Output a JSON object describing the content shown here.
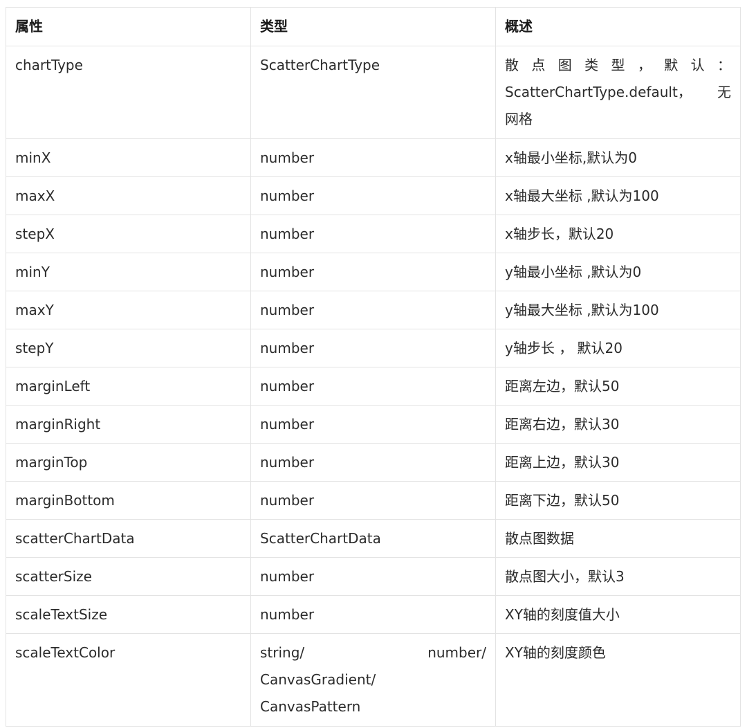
{
  "headers": {
    "property": "属性",
    "type": "类型",
    "description": "概述"
  },
  "rows": [
    {
      "property": "chartType",
      "type": "ScatterChartType",
      "description_line1": [
        "散",
        "点",
        "图",
        "类",
        "型",
        "，",
        "默",
        "认",
        "："
      ],
      "description_line2a": "ScatterChartType.default，",
      "description_line2b": "无",
      "description_line3": "网格"
    },
    {
      "property": "minX",
      "type": "number",
      "description": "x轴最小坐标,默认为0"
    },
    {
      "property": "maxX",
      "type": "number",
      "description": "x轴最大坐标 ,默认为100"
    },
    {
      "property": "stepX",
      "type": "number",
      "description": "x轴步长，默认20"
    },
    {
      "property": "minY",
      "type": "number",
      "description": "y轴最小坐标 ,默认为0"
    },
    {
      "property": "maxY",
      "type": "number",
      "description": "y轴最大坐标 ,默认为100"
    },
    {
      "property": "stepY",
      "type": "number",
      "description": "y轴步长 ， 默认20"
    },
    {
      "property": "marginLeft",
      "type": "number",
      "description": "距离左边，默认50"
    },
    {
      "property": "marginRight",
      "type": "number",
      "description": "距离右边，默认30"
    },
    {
      "property": "marginTop",
      "type": "number",
      "description": "距离上边，默认30"
    },
    {
      "property": "marginBottom",
      "type": "number",
      "description": "距离下边，默认50"
    },
    {
      "property": "scatterChartData",
      "type": "ScatterChartData",
      "description": "散点图数据"
    },
    {
      "property": "scatterSize",
      "type": "number",
      "description": "散点图大小，默认3"
    },
    {
      "property": "scaleTextSize",
      "type": "number",
      "description": "XY轴的刻度值大小"
    },
    {
      "property": "scaleTextColor",
      "type_line1a": "string/",
      "type_line1b": "number/",
      "type_line2": "CanvasGradient/",
      "type_line3": "CanvasPattern",
      "description": "XY轴的刻度颜色"
    }
  ]
}
